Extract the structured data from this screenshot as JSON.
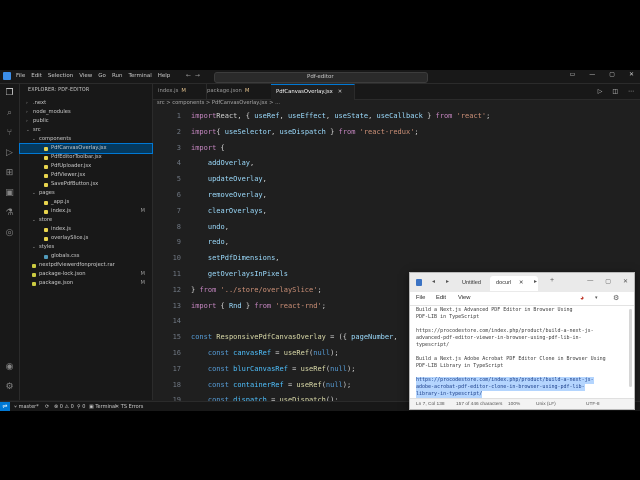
{
  "window": {
    "menu": [
      "File",
      "Edit",
      "Selection",
      "View",
      "Go",
      "Run",
      "Terminal",
      "Help"
    ],
    "search": "Pdf-editor"
  },
  "explorer": {
    "title": "EXPLORER: PDF-EDITOR",
    "items": [
      {
        "label": ".next",
        "depth": 0,
        "type": "folder",
        "open": false
      },
      {
        "label": "node_modules",
        "depth": 0,
        "type": "folder",
        "open": false
      },
      {
        "label": "public",
        "depth": 0,
        "type": "folder",
        "open": false
      },
      {
        "label": "src",
        "depth": 0,
        "type": "folder",
        "open": true
      },
      {
        "label": "components",
        "depth": 1,
        "type": "folder",
        "open": true
      },
      {
        "label": "PdfCanvasOverlay.jsx",
        "depth": 2,
        "type": "file",
        "selected": true
      },
      {
        "label": "PdfEditorToolbar.jsx",
        "depth": 2,
        "type": "file"
      },
      {
        "label": "PdfUploader.jsx",
        "depth": 2,
        "type": "file"
      },
      {
        "label": "PdfViewer.jsx",
        "depth": 2,
        "type": "file"
      },
      {
        "label": "SavePdfButton.jsx",
        "depth": 2,
        "type": "file"
      },
      {
        "label": "pages",
        "depth": 1,
        "type": "folder",
        "open": true
      },
      {
        "label": "_app.js",
        "depth": 2,
        "type": "file"
      },
      {
        "label": "index.js",
        "depth": 2,
        "type": "file",
        "badge": "M"
      },
      {
        "label": "store",
        "depth": 1,
        "type": "folder",
        "open": true
      },
      {
        "label": "index.js",
        "depth": 2,
        "type": "file"
      },
      {
        "label": "overlaySlice.js",
        "depth": 2,
        "type": "file"
      },
      {
        "label": "styles",
        "depth": 1,
        "type": "folder",
        "open": true
      },
      {
        "label": "globals.css",
        "depth": 2,
        "type": "file"
      },
      {
        "label": "nextpdfviewerdfonproject.rar",
        "depth": 0,
        "type": "file"
      },
      {
        "label": "package-lock.json",
        "depth": 0,
        "type": "file",
        "badge": "M"
      },
      {
        "label": "package.json",
        "depth": 0,
        "type": "file",
        "badge": "M"
      }
    ]
  },
  "tabs": [
    {
      "label": "index.js",
      "mod": "M",
      "active": false
    },
    {
      "label": "package.json",
      "mod": "M",
      "active": false
    },
    {
      "label": "PdfCanvasOverlay.jsx",
      "mod": "",
      "active": true
    }
  ],
  "breadcrumb": "src > components > PdfCanvasOverlay.jsx > ...",
  "editor": {
    "lines": [
      {
        "n": "1",
        "t": [
          [
            "kw",
            "import"
          ],
          [
            "",
            "React, { "
          ],
          [
            "var",
            "useRef"
          ],
          [
            "",
            ", "
          ],
          [
            "var",
            "useEffect"
          ],
          [
            "",
            ", "
          ],
          [
            "var",
            "useState"
          ],
          [
            "",
            ", "
          ],
          [
            "var",
            "useCallback"
          ],
          [
            "",
            " } "
          ],
          [
            "kw",
            "from"
          ],
          [
            "",
            ""
          ],
          [
            "str",
            " 'react'"
          ],
          [
            "",
            ";"
          ]
        ]
      },
      {
        "n": "2",
        "t": [
          [
            "kw",
            "import"
          ],
          [
            "",
            "",
            " "
          ],
          [
            "",
            ""
          ],
          [
            "",
            ""
          ],
          [
            "",
            "{ "
          ],
          [
            "var",
            "useSelector"
          ],
          [
            "",
            ", "
          ],
          [
            "var",
            "useDispatch"
          ],
          [
            "",
            " } "
          ],
          [
            "kw",
            "from"
          ],
          [
            "str",
            " 'react-redux'"
          ],
          [
            "",
            ";"
          ]
        ]
      },
      {
        "n": "3",
        "t": [
          [
            "kw",
            "import"
          ],
          [
            "",
            " {"
          ]
        ]
      },
      {
        "n": "4",
        "t": [
          [
            "",
            "    "
          ],
          [
            "var",
            "addOverlay"
          ],
          [
            "",
            ","
          ]
        ]
      },
      {
        "n": "5",
        "t": [
          [
            "",
            "    "
          ],
          [
            "var",
            "updateOverlay"
          ],
          [
            "",
            ","
          ]
        ]
      },
      {
        "n": "6",
        "t": [
          [
            "",
            "    "
          ],
          [
            "var",
            "removeOverlay"
          ],
          [
            "",
            ","
          ]
        ]
      },
      {
        "n": "7",
        "t": [
          [
            "",
            "    "
          ],
          [
            "var",
            "clearOverlays"
          ],
          [
            "",
            ","
          ]
        ]
      },
      {
        "n": "8",
        "t": [
          [
            "",
            "    "
          ],
          [
            "var",
            "undo"
          ],
          [
            "",
            ","
          ]
        ]
      },
      {
        "n": "9",
        "t": [
          [
            "",
            "    "
          ],
          [
            "var",
            "redo"
          ],
          [
            "",
            ","
          ]
        ]
      },
      {
        "n": "10",
        "t": [
          [
            "",
            "    "
          ],
          [
            "var",
            "setPdfDimensions"
          ],
          [
            "",
            ","
          ]
        ]
      },
      {
        "n": "11",
        "t": [
          [
            "",
            "    "
          ],
          [
            "var",
            "getOverlaysInPixels"
          ]
        ]
      },
      {
        "n": "12",
        "t": [
          [
            "",
            "} "
          ],
          [
            "kw",
            "from"
          ],
          [
            "str",
            " '../store/overlaySlice'"
          ],
          [
            "",
            ";"
          ]
        ]
      },
      {
        "n": "13",
        "t": [
          [
            "kw",
            "import"
          ],
          [
            "",
            " { "
          ],
          [
            "var",
            "Rnd"
          ],
          [
            "",
            " } "
          ],
          [
            "kw",
            "from"
          ],
          [
            "str",
            " 'react-rnd'"
          ],
          [
            "",
            ";"
          ]
        ]
      },
      {
        "n": "14",
        "t": []
      },
      {
        "n": "15",
        "t": [
          [
            "k2",
            "const"
          ],
          [
            "",
            " "
          ],
          [
            "fn",
            "ResponsivePdfCanvasOverlay"
          ],
          [
            "",
            " = ({ "
          ],
          [
            "var",
            "pageNumber"
          ],
          [
            "",
            ", "
          ]
        ]
      },
      {
        "n": "16",
        "t": [
          [
            "",
            "    "
          ],
          [
            "k2",
            "const"
          ],
          [
            "",
            " "
          ],
          [
            "cn",
            "canvasRef"
          ],
          [
            "",
            " = "
          ],
          [
            "fn",
            "useRef"
          ],
          [
            "",
            "("
          ],
          [
            "k2",
            "null"
          ],
          [
            "",
            ");"
          ]
        ]
      },
      {
        "n": "17",
        "t": [
          [
            "",
            "    "
          ],
          [
            "k2",
            "const"
          ],
          [
            "",
            " "
          ],
          [
            "cn",
            "blurCanvasRef"
          ],
          [
            "",
            " = "
          ],
          [
            "fn",
            "useRef"
          ],
          [
            "",
            "("
          ],
          [
            "k2",
            "null"
          ],
          [
            "",
            ");"
          ]
        ]
      },
      {
        "n": "18",
        "t": [
          [
            "",
            "    "
          ],
          [
            "k2",
            "const"
          ],
          [
            "",
            " "
          ],
          [
            "cn",
            "containerRef"
          ],
          [
            "",
            " = "
          ],
          [
            "fn",
            "useRef"
          ],
          [
            "",
            "("
          ],
          [
            "k2",
            "null"
          ],
          [
            "",
            ");"
          ]
        ]
      },
      {
        "n": "19",
        "t": [
          [
            "",
            "    "
          ],
          [
            "k2",
            "const"
          ],
          [
            "",
            " "
          ],
          [
            "cn",
            "dispatch"
          ],
          [
            "",
            " = "
          ],
          [
            "fn",
            "useDispatch"
          ],
          [
            "",
            "();"
          ]
        ]
      }
    ]
  },
  "status": {
    "branch": "master*",
    "problems": "0 ⚠ 0",
    "ports": "0",
    "terminal": "Terminal",
    "extra": "TS Errors"
  },
  "notepad": {
    "tabs": [
      "Untitled",
      "docurl"
    ],
    "menu": [
      "File",
      "Edit",
      "View"
    ],
    "lines": [
      {
        "text": "Build a Next.js Advanced PDF Editor in Browser Using",
        "sel": false
      },
      {
        "text": "PDF-LIB in TypeScript",
        "sel": false
      },
      {
        "text": "",
        "sel": false
      },
      {
        "text": "https://procodestore.com/index.php/product/build-a-next-js-",
        "sel": false
      },
      {
        "text": "advanced-pdf-editor-viewer-in-browser-using-pdf-lib-in-",
        "sel": false
      },
      {
        "text": "typescript/",
        "sel": false
      },
      {
        "text": "",
        "sel": false
      },
      {
        "text": "Build a Next.js Adobe Acrobat PDF Editor Clone in Browser Using",
        "sel": false
      },
      {
        "text": "PDF-LIB Library in TypeScript",
        "sel": false
      },
      {
        "text": "",
        "sel": false
      },
      {
        "text": "https://procodestore.com/index.php/product/build-a-next-js-",
        "sel": true
      },
      {
        "text": "adobe-acrobat-pdf-editor-clone-in-browser-using-pdf-lib-",
        "sel": true
      },
      {
        "text": "library-in-typescript/",
        "sel": true
      }
    ],
    "status": {
      "position": "Ln 7, Col 138",
      "chars": "157 of 446 characters",
      "zoom": "100%",
      "eol": "Unix (LF)",
      "encoding": "UTF-8"
    }
  }
}
